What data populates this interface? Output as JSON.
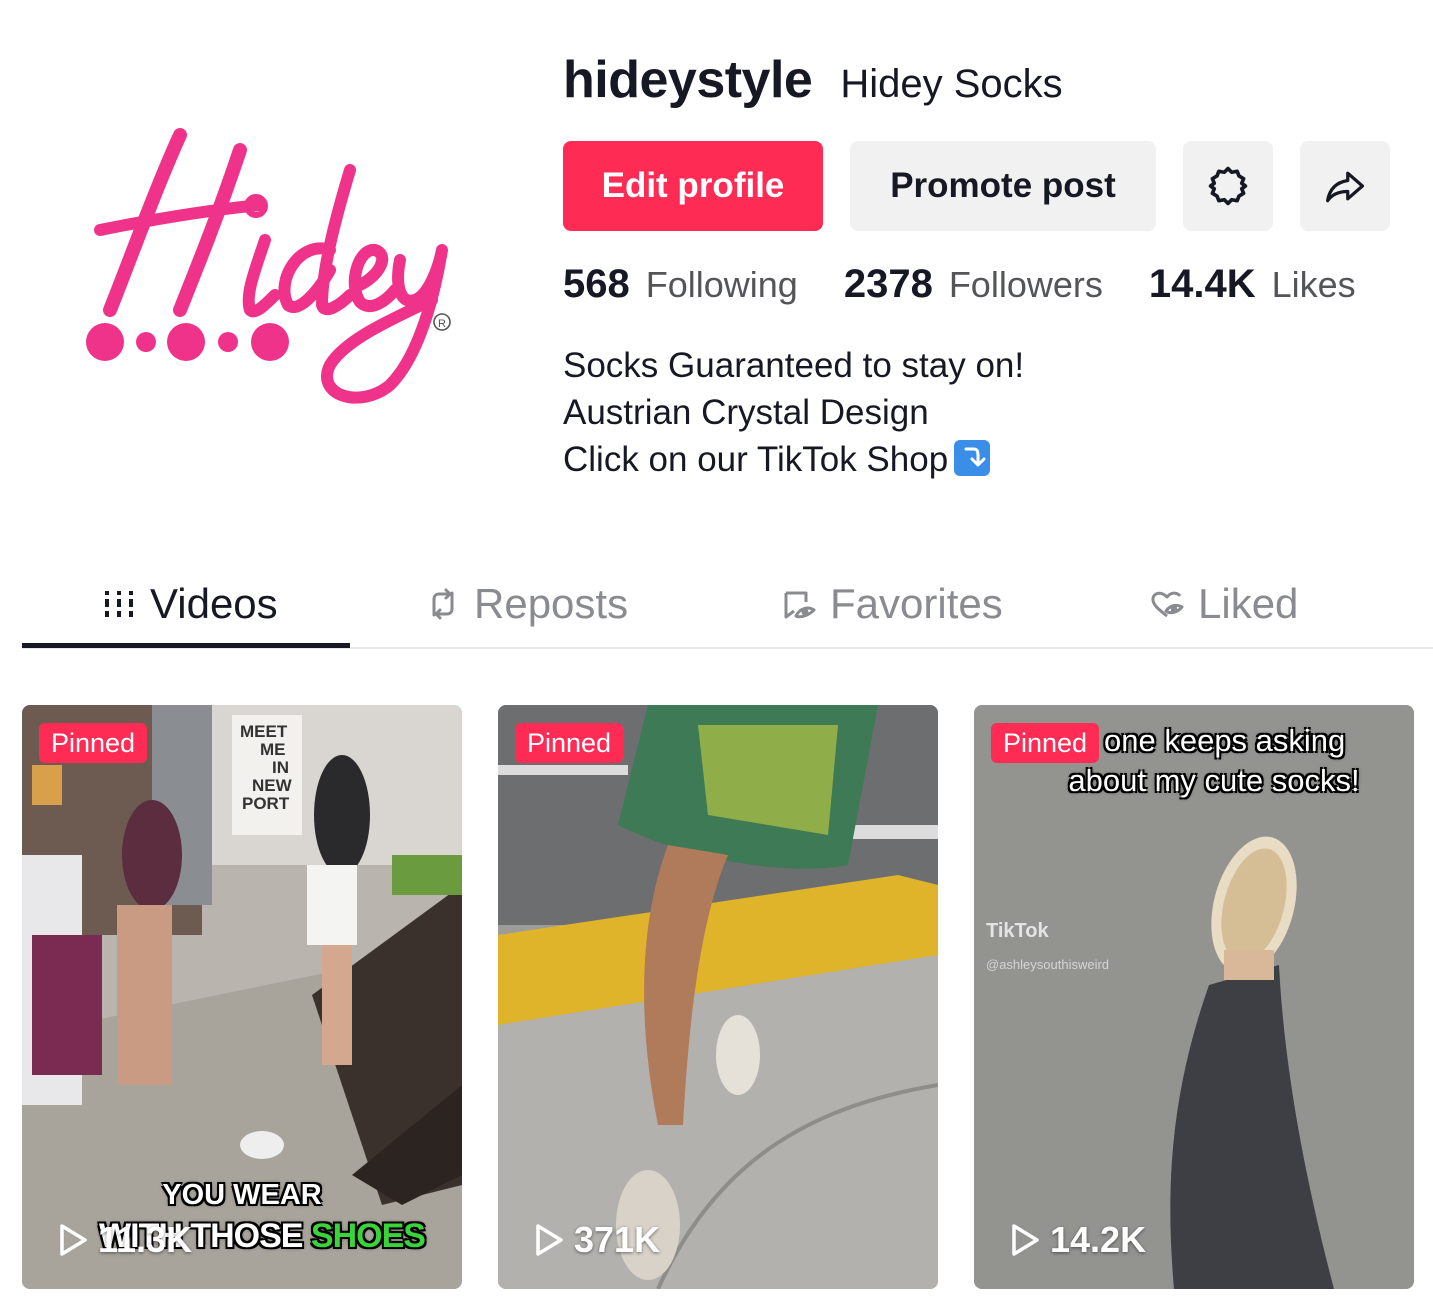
{
  "profile": {
    "username": "hideystyle",
    "nickname": "Hidey Socks",
    "avatar_icon": "hidey-logo",
    "brand_color": "#fe2c55",
    "logo_color": "#f0338a",
    "buttons": {
      "edit_profile": "Edit profile",
      "promote_post": "Promote post",
      "settings_icon": "gear-icon",
      "share_icon": "share-arrow-icon"
    },
    "stats": [
      {
        "value": "568",
        "label": "Following"
      },
      {
        "value": "2378",
        "label": "Followers"
      },
      {
        "value": "14.4K",
        "label": "Likes"
      }
    ],
    "bio": [
      "Socks Guaranteed to stay on!",
      "Austrian Crystal Design",
      "Click on our TikTok Shop"
    ],
    "bio_emoji": "arrow-down-box-emoji"
  },
  "tabs": [
    {
      "label": "Videos",
      "icon": "grid-icon",
      "active": true
    },
    {
      "label": "Reposts",
      "icon": "repost-icon",
      "active": false
    },
    {
      "label": "Favorites",
      "icon": "bookmark-icon",
      "active": false
    },
    {
      "label": "Liked",
      "icon": "heart-icon",
      "active": false
    }
  ],
  "videos": [
    {
      "badge": "Pinned",
      "views": "11.3K",
      "caption_top": "YOU WEAR",
      "caption_bottom_white": "WITH THOSE",
      "caption_bottom_green": "SHOES",
      "sign_text": "MEET ME IN NEW PORT"
    },
    {
      "badge": "Pinned",
      "views": "371K"
    },
    {
      "badge": "Pinned",
      "views": "14.2K",
      "caption_line1": "one keeps asking",
      "caption_line2": "about my cute socks!",
      "watermark": "TikTok",
      "watermark_handle": "@ashleysouthisweird"
    }
  ]
}
